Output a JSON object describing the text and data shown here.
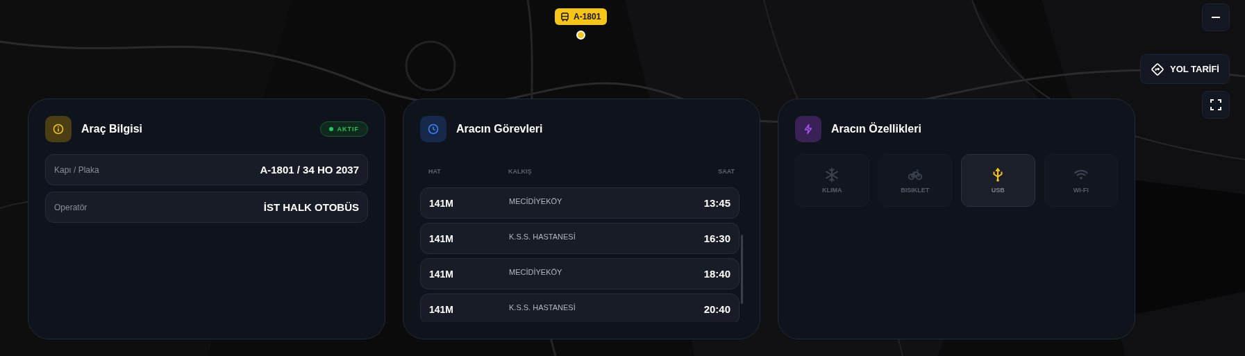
{
  "map": {
    "kind": "picture",
    "marker": {
      "label": "A-1801"
    }
  },
  "map_controls": {
    "directions_button": "YOL TARİFİ"
  },
  "vehicle_info": {
    "title": "Araç Bilgisi",
    "status": {
      "label": "AKTIF",
      "active": true
    },
    "fields": [
      {
        "label": "Kapı / Plaka",
        "value": "A-1801 / 34 HO 2037"
      },
      {
        "label": "Operatör",
        "value": "İST HALK OTOBÜS"
      }
    ]
  },
  "tasks": {
    "title": "Aracın Görevleri",
    "columns": [
      "HAT",
      "KALKIŞ",
      "SAAT"
    ],
    "rows": [
      {
        "line": "141M",
        "departure": "MECİDİYEKÖY",
        "time": "13:45"
      },
      {
        "line": "141M",
        "departure": "K.S.S. HASTANESİ",
        "time": "16:30"
      },
      {
        "line": "141M",
        "departure": "MECİDİYEKÖY",
        "time": "18:40"
      },
      {
        "line": "141M",
        "departure": "K.S.S. HASTANESİ",
        "time": "20:40"
      }
    ]
  },
  "features": {
    "title": "Aracın Özellikleri",
    "items": [
      {
        "kind": "snowflake",
        "label": "KLIMA",
        "available": false
      },
      {
        "kind": "bicycle",
        "label": "BISIKLET",
        "available": false
      },
      {
        "kind": "usb",
        "label": "USB",
        "available": true
      },
      {
        "kind": "wifi",
        "label": "WI-FI",
        "available": false
      }
    ]
  }
}
